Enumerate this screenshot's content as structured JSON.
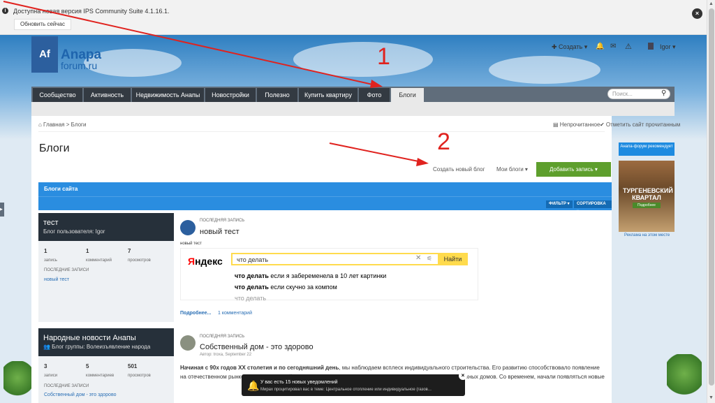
{
  "update_bar": {
    "message": "Доступна новая версия IPS Community Suite 4.1.16.1.",
    "button_label": "Обновить сейчас",
    "close": "×"
  },
  "logo": {
    "mark": "Af",
    "line1": "Anapa",
    "line2": "forum.ru"
  },
  "userbar": {
    "create": "✚ Создать ▾",
    "user": "Igor ▾"
  },
  "nav": {
    "tabs": [
      "Сообщество",
      "Активность",
      "Недвижимость Анапы",
      "Новостройки",
      "Полезно",
      "Купить квартиру",
      "Фото",
      "Блоги"
    ],
    "active": "Блоги",
    "search_placeholder": "Поиск..."
  },
  "breadcrumb": {
    "home": "⌂ Главная",
    "sep": ">",
    "current": "Блоги"
  },
  "breadcrumb_right": {
    "unread": "▤ Непрочитанное",
    "mark_read": "✔ Отметить сайт прочитанным"
  },
  "page_title": "Блоги",
  "actions": {
    "create_blog": "Создать новый блог",
    "my_blogs": "Мои блоги ▾",
    "add_entry": "Добавить запись ▾"
  },
  "blog_section": {
    "title": "Блоги сайта",
    "filter": "ФИЛЬТР ▾",
    "sort": "СОРТИРОВКА ▾"
  },
  "blogs": [
    {
      "name": "тест",
      "subtitle": "Блог пользователя: Igor",
      "stats": [
        {
          "v": "1",
          "l": "запись"
        },
        {
          "v": "1",
          "l": "комментарий"
        },
        {
          "v": "7",
          "l": "просмотров"
        }
      ],
      "recent_label": "ПОСЛЕДНИЕ ЗАПИСИ",
      "recent": [
        "новый тест"
      ],
      "entry_label": "ПОСЛЕДНЯЯ ЗАПИСЬ",
      "entry_title": "новый тест",
      "entry_sub": "новый тест",
      "more": "Подробнее...",
      "comments": "1 комментарий"
    },
    {
      "name": "Народные новости Анапы",
      "subtitle": "👥 Блог группы: Волеизъявление народа",
      "stats": [
        {
          "v": "3",
          "l": "записи"
        },
        {
          "v": "5",
          "l": "комментариев"
        },
        {
          "v": "501",
          "l": "просмотров"
        }
      ],
      "recent_label": "ПОСЛЕДНИЕ ЗАПИСИ",
      "recent": [
        "Собственный дом - это здорово"
      ],
      "entry_label": "ПОСЛЕДНЯЯ ЗАПИСЬ",
      "entry_title": "Собственный дом - это здорово",
      "entry_author": "Автор: troxa, September 22",
      "para_bold": "Начиная с 90х годов XX столетия и по сегодняшний день",
      "para_text": ", мы наблюдаем всплеск индивидуального строительства. Его развитию способствовало появление на отечественном рынке новых технологий и материалов, а также отмена запрета на строительство малоэтажных домов. Со временем, начали появляться новые"
    }
  ],
  "yandex": {
    "logo_y": "Я",
    "logo_rest": "ндекс",
    "query": "что делать",
    "find": "Найти",
    "suggestions": [
      {
        "b": "что делать",
        "t": " если я забеременела в 10 лет картинки"
      },
      {
        "b": "что делать",
        "t": " если скучно за компом"
      },
      {
        "b": "",
        "t": "что делать"
      }
    ]
  },
  "sidebar": {
    "promo": "Анапа-форум рекомендует",
    "ad_title": "ТУРГЕНЕВСКИЙ КВАРТАЛ",
    "ad_btn": "Подробнее",
    "ad_link": "Реклама на этом месте"
  },
  "annotations": {
    "n1": "1",
    "n2": "2"
  },
  "notification": {
    "title": "У вас есть 15 новых уведомлений",
    "text": "Мирах процитировал вас в теме: Центральное отопление или индивидуальное (газов..."
  },
  "colors": {
    "nav": "#606d7b",
    "tab": "#333a42",
    "blue": "#2a8de0",
    "green": "#5e9f2d",
    "arrow": "#e0221e"
  }
}
